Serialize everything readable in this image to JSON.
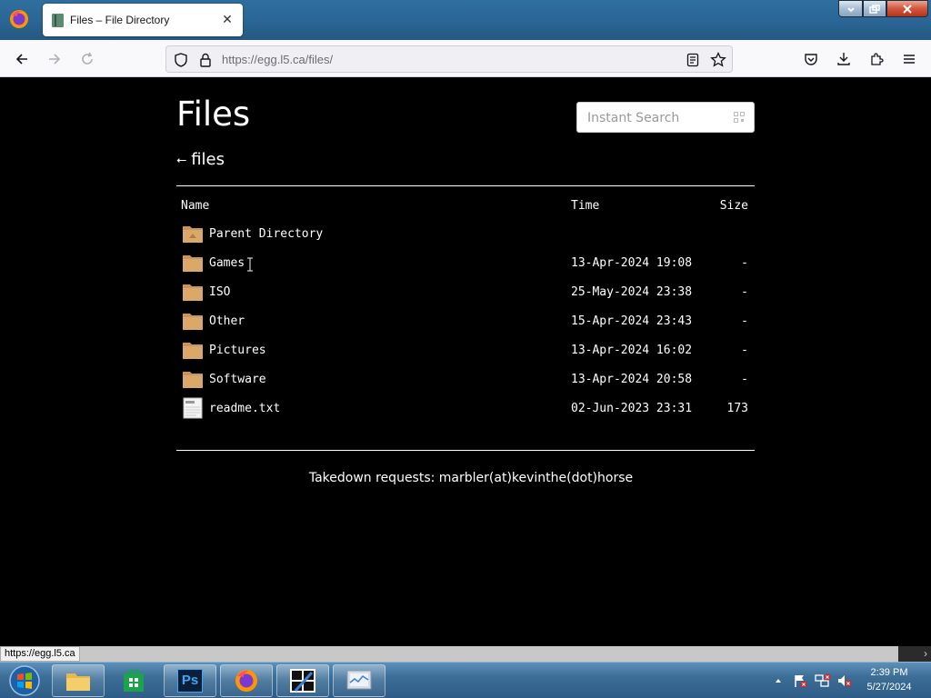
{
  "browser": {
    "tab_title": "Files – File Directory",
    "url_host": "https://egg.l5.ca",
    "url_path": "/files/",
    "status_link": "https://egg.l5.ca"
  },
  "page": {
    "title": "Files",
    "search_placeholder": "Instant Search",
    "breadcrumb_arrow": "⭠",
    "breadcrumb_label": "files",
    "columns": {
      "name": "Name",
      "time": "Time",
      "size": "Size"
    },
    "rows": [
      {
        "name": "Parent Directory",
        "time": "",
        "size": "",
        "icon": "parent-folder-icon"
      },
      {
        "name": "Games",
        "time": "13-Apr-2024 19:08",
        "size": "-",
        "icon": "folder-icon"
      },
      {
        "name": "ISO",
        "time": "25-May-2024 23:38",
        "size": "-",
        "icon": "folder-icon"
      },
      {
        "name": "Other",
        "time": "15-Apr-2024 23:43",
        "size": "-",
        "icon": "folder-icon"
      },
      {
        "name": "Pictures",
        "time": "13-Apr-2024 16:02",
        "size": "-",
        "icon": "folder-icon"
      },
      {
        "name": "Software",
        "time": "13-Apr-2024 20:58",
        "size": "-",
        "icon": "folder-icon"
      },
      {
        "name": "readme.txt",
        "time": "02-Jun-2023 23:31",
        "size": "173",
        "icon": "text-file-icon"
      }
    ],
    "footer": "Takedown requests: marbler(at)kevinthe(dot)horse"
  },
  "taskbar": {
    "clock_time": "2:39 PM",
    "clock_date": "5/27/2024",
    "apps": [
      "file-explorer-icon",
      "store-icon",
      "photoshop-icon",
      "firefox-icon",
      "app-icon",
      "system-monitor-icon"
    ],
    "photoshop_label": "Ps"
  },
  "colors": {
    "page_background": "#000000",
    "text": "#ffffff",
    "folder": "#d9a96a"
  }
}
